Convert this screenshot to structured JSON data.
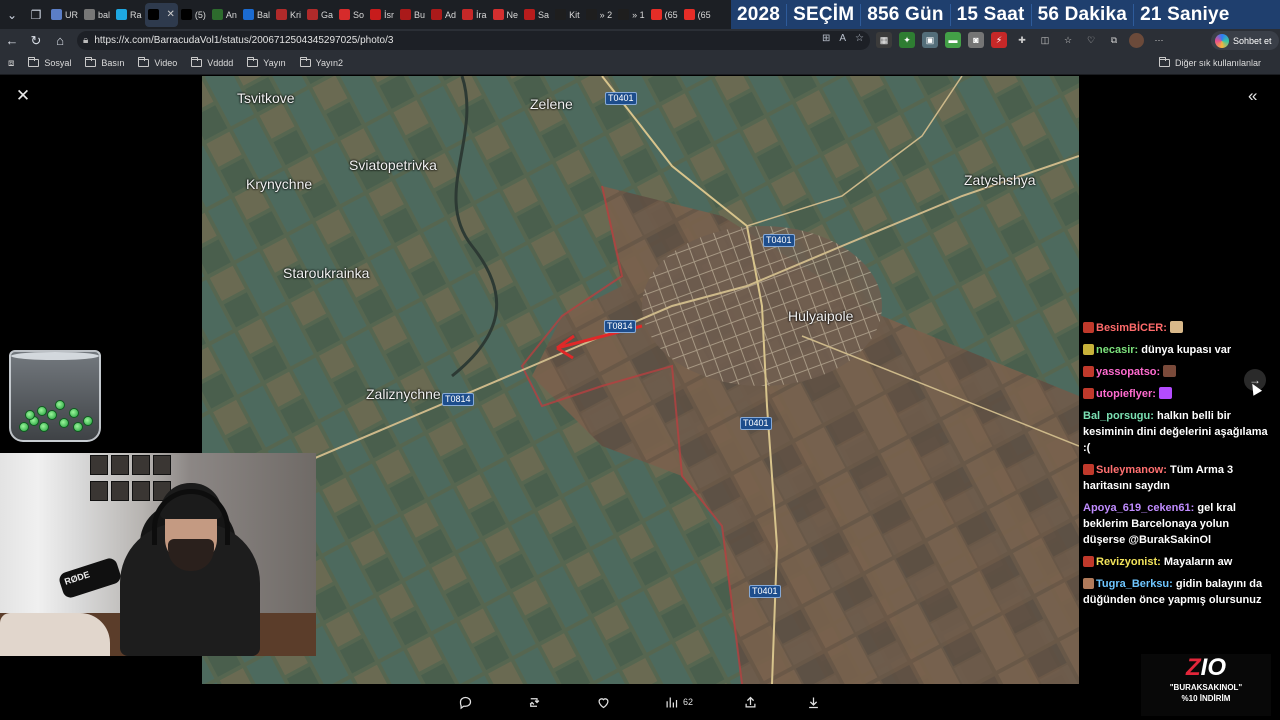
{
  "tabs": [
    {
      "label": "UR",
      "icon": "square-icon",
      "color": "#5b7ec7"
    },
    {
      "label": "bal",
      "icon": "globe-icon",
      "color": "#777777"
    },
    {
      "label": "Ra",
      "icon": "circle-icon",
      "color": "#1ea7e1"
    },
    {
      "label": "",
      "icon": "x-logo-icon",
      "color": "#000000",
      "active": true
    },
    {
      "label": "(5)",
      "icon": "x-logo-icon",
      "color": "#000000"
    },
    {
      "label": "An",
      "icon": "lines-icon",
      "color": "#2d6b2d"
    },
    {
      "label": "Bal",
      "icon": "news-icon",
      "color": "#1b6bd1"
    },
    {
      "label": "Kri",
      "icon": "k-icon",
      "color": "#b02a2a"
    },
    {
      "label": "Ga",
      "icon": "g-icon",
      "color": "#b02a2a"
    },
    {
      "label": "So",
      "icon": "flag-icon",
      "color": "#d62b2b"
    },
    {
      "label": "İsr",
      "icon": "t-icon",
      "color": "#c71c1c"
    },
    {
      "label": "Bu",
      "icon": "news-icon",
      "color": "#aa1a1a"
    },
    {
      "label": "Ad",
      "icon": "news-icon",
      "color": "#aa1a1a"
    },
    {
      "label": "İra",
      "icon": "news-icon",
      "color": "#c62828"
    },
    {
      "label": "Ne",
      "icon": "p-icon",
      "color": "#d32f2f"
    },
    {
      "label": "Sa",
      "icon": "slash-icon",
      "color": "#b71c1c"
    },
    {
      "label": "Kit",
      "icon": "book-icon",
      "color": "#1e1e1e"
    },
    {
      "label": "» 2",
      "icon": "ten-icon",
      "color": "#1e1e1e"
    },
    {
      "label": "» 1",
      "icon": "ten-icon",
      "color": "#1e1e1e"
    },
    {
      "label": "(65",
      "icon": "youtube-icon",
      "color": "#e52d27"
    },
    {
      "label": "(65",
      "icon": "youtube-icon",
      "color": "#e52d27"
    }
  ],
  "countdown": {
    "year": "2028",
    "label": "SEÇİM",
    "days": "856 Gün",
    "hours": "15 Saat",
    "minutes": "56 Dakika",
    "seconds": "21 Saniye"
  },
  "address": {
    "url": "https://x.com/BarracudaVol1/status/2006712504345297025/photo/3"
  },
  "copilot": {
    "label": "Sohbet et"
  },
  "bookmarks": {
    "items": [
      "Sosyal",
      "Basın",
      "Video",
      "Vdddd",
      "Yayın",
      "Yayın2"
    ],
    "other": "Diğer sık kullanılanlar"
  },
  "map": {
    "places": [
      "Tsvitkove",
      "Zelene",
      "Krynychne",
      "Sviatopetrivka",
      "Zatyshshya",
      "Staroukrainka",
      "Hulyaipole",
      "Zaliznychne"
    ],
    "roads": [
      "T0401",
      "T0401",
      "T0814",
      "T0814",
      "T0401",
      "T0401"
    ]
  },
  "actions": {
    "views": "62"
  },
  "chat": [
    {
      "user": "BesimBİCER:",
      "text": "",
      "user_color": "#ff6b6b",
      "badge_color": "#c0392b",
      "emote": "#d9b98a"
    },
    {
      "user": "necasir:",
      "text": "dünya kupası var",
      "user_color": "#7be07b",
      "badge_color": "#c8b23a"
    },
    {
      "user": "yassopatso:",
      "text": "",
      "user_color": "#ff6bcf",
      "badge_color": "#c0392b",
      "emote": "#7a4a3a"
    },
    {
      "user": "utopieflyer:",
      "text": "",
      "user_color": "#ff6bcf",
      "badge_color": "#c0392b",
      "emote": "#b44cff"
    },
    {
      "user": "Bal_porsugu:",
      "text": "halkın belli bir kesiminin dini değelerini aşağılama :(",
      "user_color": "#7be0b3",
      "badge_color": ""
    },
    {
      "user": "Suleymanow:",
      "text": "Tüm Arma 3 haritasını saydın",
      "user_color": "#ff7070",
      "badge_color": "#c0392b"
    },
    {
      "user": "Apoya_619_ceken61:",
      "text": "gel kral beklerim Barcelonaya yolun düşerse @BurakSakinOl",
      "user_color": "#c08cff",
      "badge_color": ""
    },
    {
      "user": "Revizyonist:",
      "text": "Mayaların aw",
      "user_color": "#f2e35b",
      "badge_color": "#c0392b"
    },
    {
      "user": "Tugra_Berksu:",
      "text": "gidin balayını da düğünden önce yapmış olursunuz",
      "user_color": "#6ec6ff",
      "badge_color": "#b07a5a"
    }
  ],
  "promo": {
    "logo_prefix": "Z",
    "logo_suffix": "IO",
    "line1": "\"BURAKSAKINOL\"",
    "line2": "%10 İNDİRİM"
  },
  "mic_brand": "RØDE"
}
